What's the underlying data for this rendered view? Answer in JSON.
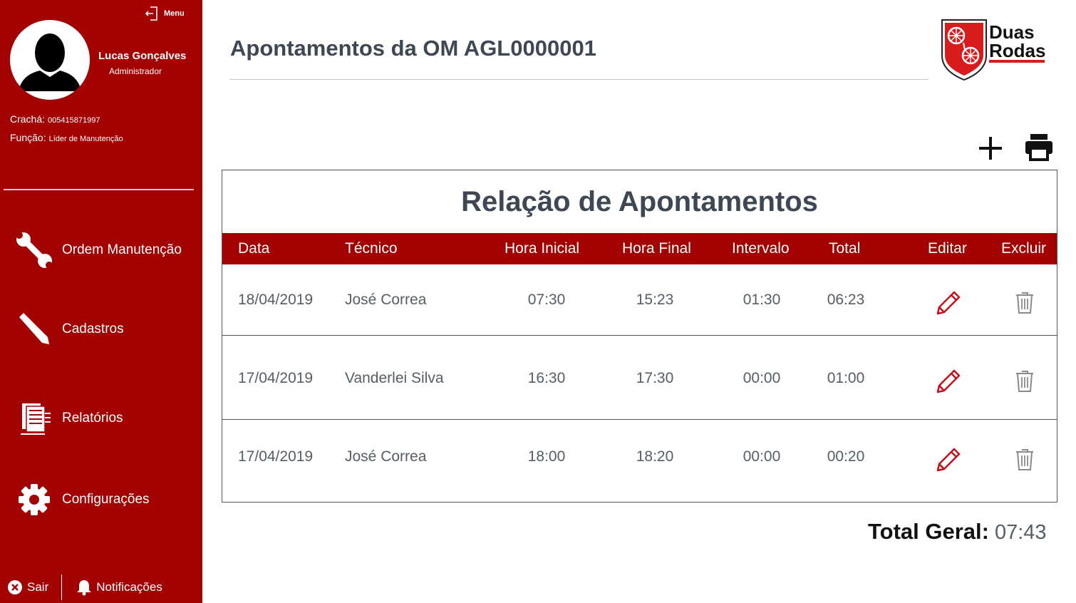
{
  "sidebar": {
    "menu_label": "Menu",
    "user": {
      "name": "Lucas Gonçalves",
      "role": "Administrador"
    },
    "badge": {
      "label": "Crachá:",
      "value": "005415871997"
    },
    "function": {
      "label": "Função:",
      "value": "Líder de Manutenção"
    },
    "nav": [
      {
        "label": "Ordem Manutenção",
        "icon": "wrench-icon"
      },
      {
        "label": "Cadastros",
        "icon": "pencil-icon"
      },
      {
        "label": "Relatórios",
        "icon": "report-icon"
      },
      {
        "label": "Configurações",
        "icon": "gear-icon"
      }
    ],
    "footer": {
      "exit_label": "Sair",
      "notifications_label": "Notificações"
    }
  },
  "header": {
    "title": "Apontamentos da OM AGL0000001",
    "logo_text": [
      "Duas",
      "Rodas"
    ]
  },
  "toolbar": {
    "add_icon": "plus-icon",
    "print_icon": "printer-icon"
  },
  "table": {
    "title": "Relação de Apontamentos",
    "columns": [
      "Data",
      "Técnico",
      "Hora Inicial",
      "Hora Final",
      "Intervalo",
      "Total",
      "Editar",
      "Excluir"
    ],
    "rows": [
      {
        "data": "18/04/2019",
        "tecnico": "José Correa",
        "hora_inicial": "07:30",
        "hora_final": "15:23",
        "intervalo": "01:30",
        "total": "06:23"
      },
      {
        "data": "17/04/2019",
        "tecnico": "Vanderlei Silva",
        "hora_inicial": "16:30",
        "hora_final": "17:30",
        "intervalo": "00:00",
        "total": "01:00"
      },
      {
        "data": "17/04/2019",
        "tecnico": "José Correa",
        "hora_inicial": "18:00",
        "hora_final": "18:20",
        "intervalo": "00:00",
        "total": "00:20"
      }
    ]
  },
  "summary": {
    "label": "Total Geral:",
    "value": "07:43"
  },
  "colors": {
    "brand_red": "#a30202",
    "text_dark": "#3e4854",
    "text_muted": "#555e66",
    "edit_red": "#c0101a",
    "trash_gray": "#8a8a8a"
  }
}
